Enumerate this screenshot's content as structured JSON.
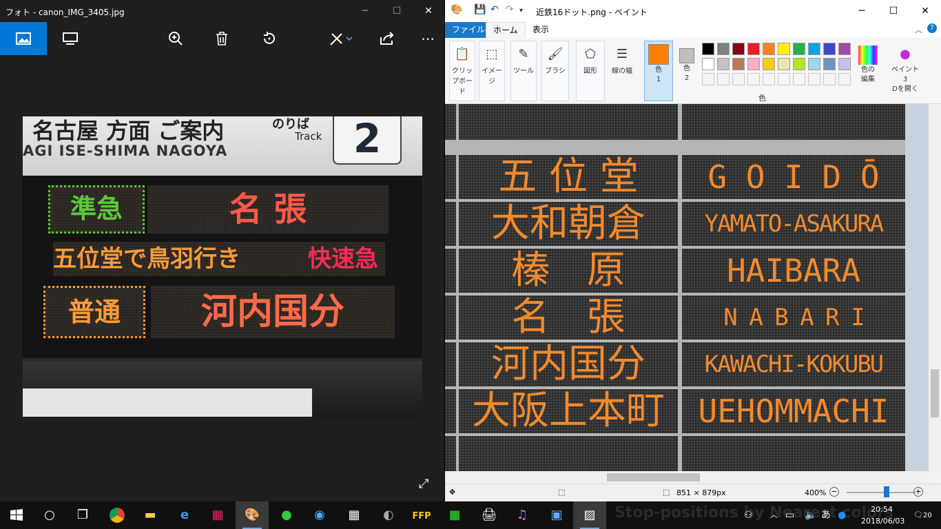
{
  "photos": {
    "window_title": "フォト - canon_IMG_3405.jpg",
    "window_controls": {
      "minimize": "─",
      "maximize": "☐",
      "close": "✕"
    },
    "photo_text": {
      "sign_jp": "名古屋 方面  ご案内",
      "sign_en": "AGI  ISE-SHIMA  NAGOYA",
      "noriba": "のりば",
      "track": "Track",
      "track_number": "2",
      "row1_type": "準急",
      "row1_dest": "名  張",
      "row2_scroll": "五位堂で鳥羽行き",
      "row2_rapid": "快速急",
      "row3_type": "普通",
      "row3_dest": "河内国分"
    }
  },
  "paint": {
    "window_title": "近鉄16ドット.png - ペイント",
    "window_controls": {
      "minimize": "─",
      "maximize": "☐",
      "close": "✕"
    },
    "tabs": {
      "file": "ファイル",
      "home": "ホーム",
      "view": "表示"
    },
    "ribbon": {
      "clipboard": "クリップボード",
      "image": "イメージ",
      "tools": "ツール",
      "brushes": "ブラシ",
      "shapes": "図形",
      "line_width": "線の幅",
      "color1": "色\n1",
      "color2": "色\n2",
      "colors_group": "色",
      "edit_colors": "色の\n編集",
      "paint3d": "ペイント3\nDを開く"
    },
    "color1_value": "#ff7f00",
    "color2_value": "#c0c0c0",
    "palette": [
      "#000000",
      "#7f7f7f",
      "#880015",
      "#ed1c24",
      "#ff7f27",
      "#fff200",
      "#22b14c",
      "#00a2e8",
      "#3f48cc",
      "#a349a4",
      "#ffffff",
      "#c3c3c3",
      "#b97a57",
      "#ffaec9",
      "#ffc90e",
      "#efe4b0",
      "#b5e61d",
      "#99d9ea",
      "#7092be",
      "#c8bfe7"
    ],
    "stations": [
      {
        "jp": "五 位 堂",
        "en": "G O I D Ō"
      },
      {
        "jp": "大和朝倉",
        "en": "YAMATO-ASAKURA"
      },
      {
        "jp": "榛   原",
        "en": "HAIBARA"
      },
      {
        "jp": "名   張",
        "en": "N A B A R I"
      },
      {
        "jp": "河内国分",
        "en": "KAWACHI-KOKUBU"
      },
      {
        "jp": "大阪上本町",
        "en": "UEHOMMACHI"
      }
    ],
    "status": {
      "dimensions": "851 × 879px",
      "zoom": "400%"
    }
  },
  "taskbar": {
    "bg_text": "Stop-positions by Nearest colors",
    "ime": "あ",
    "time": "20:54",
    "date": "2018/06/03",
    "notifications": "20"
  }
}
